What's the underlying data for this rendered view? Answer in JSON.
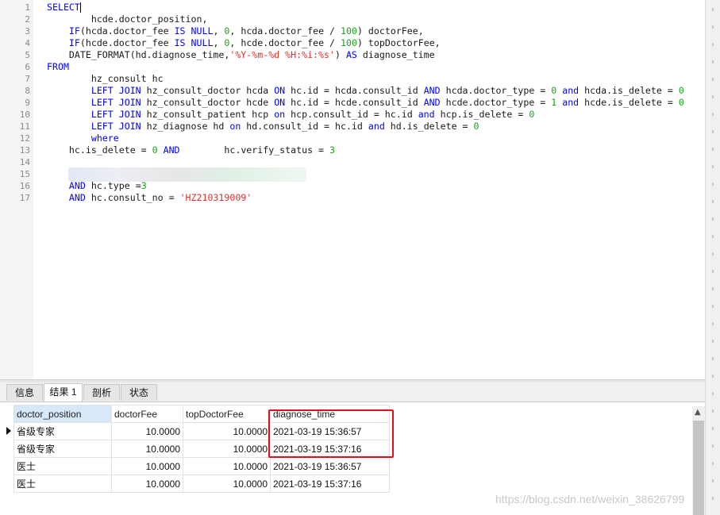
{
  "editor": {
    "line_numbers": [
      "1",
      "2",
      "3",
      "4",
      "5",
      "6",
      "7",
      "8",
      "9",
      "10",
      "11",
      "12",
      "13",
      "14",
      "15",
      "16",
      "17"
    ],
    "lines": [
      [
        {
          "t": "SELECT",
          "c": "kw"
        }
      ],
      [
        {
          "t": "        hcde.doctor_position,",
          "c": "plain"
        }
      ],
      [
        {
          "t": "    ",
          "c": "plain"
        },
        {
          "t": "IF",
          "c": "kw"
        },
        {
          "t": "(hcda.doctor_fee ",
          "c": "plain"
        },
        {
          "t": "IS NULL",
          "c": "kw"
        },
        {
          "t": ", ",
          "c": "plain"
        },
        {
          "t": "0",
          "c": "num"
        },
        {
          "t": ", hcda.doctor_fee / ",
          "c": "plain"
        },
        {
          "t": "100",
          "c": "num"
        },
        {
          "t": ") doctorFee,",
          "c": "plain"
        }
      ],
      [
        {
          "t": "    ",
          "c": "plain"
        },
        {
          "t": "IF",
          "c": "kw"
        },
        {
          "t": "(hcde.doctor_fee ",
          "c": "plain"
        },
        {
          "t": "IS NULL",
          "c": "kw"
        },
        {
          "t": ", ",
          "c": "plain"
        },
        {
          "t": "0",
          "c": "num"
        },
        {
          "t": ", hcde.doctor_fee / ",
          "c": "plain"
        },
        {
          "t": "100",
          "c": "num"
        },
        {
          "t": ") topDoctorFee,",
          "c": "plain"
        }
      ],
      [
        {
          "t": "    DATE_FORMAT(hd.diagnose_time,",
          "c": "plain"
        },
        {
          "t": "'%Y-%m-%d %H:%i:%s'",
          "c": "str"
        },
        {
          "t": ") ",
          "c": "plain"
        },
        {
          "t": "AS",
          "c": "kw"
        },
        {
          "t": " diagnose_time",
          "c": "plain"
        }
      ],
      [
        {
          "t": "FROM",
          "c": "kw"
        }
      ],
      [
        {
          "t": "        hz_consult hc",
          "c": "plain"
        }
      ],
      [
        {
          "t": "        ",
          "c": "plain"
        },
        {
          "t": "LEFT JOIN",
          "c": "kw"
        },
        {
          "t": " hz_consult_doctor hcda ",
          "c": "plain"
        },
        {
          "t": "ON",
          "c": "kw"
        },
        {
          "t": " hc.id = hcda.consult_id ",
          "c": "plain"
        },
        {
          "t": "AND",
          "c": "kw"
        },
        {
          "t": " hcda.doctor_type = ",
          "c": "plain"
        },
        {
          "t": "0",
          "c": "num"
        },
        {
          "t": " ",
          "c": "plain"
        },
        {
          "t": "and",
          "c": "kw"
        },
        {
          "t": " hcda.is_delete = ",
          "c": "plain"
        },
        {
          "t": "0",
          "c": "num"
        }
      ],
      [
        {
          "t": "        ",
          "c": "plain"
        },
        {
          "t": "LEFT JOIN",
          "c": "kw"
        },
        {
          "t": " hz_consult_doctor hcde ",
          "c": "plain"
        },
        {
          "t": "ON",
          "c": "kw"
        },
        {
          "t": " hc.id = hcde.consult_id ",
          "c": "plain"
        },
        {
          "t": "AND",
          "c": "kw"
        },
        {
          "t": " hcde.doctor_type = ",
          "c": "plain"
        },
        {
          "t": "1",
          "c": "num"
        },
        {
          "t": " ",
          "c": "plain"
        },
        {
          "t": "and",
          "c": "kw"
        },
        {
          "t": " hcde.is_delete = ",
          "c": "plain"
        },
        {
          "t": "0",
          "c": "num"
        }
      ],
      [
        {
          "t": "        ",
          "c": "plain"
        },
        {
          "t": "LEFT JOIN",
          "c": "kw"
        },
        {
          "t": " hz_consult_patient hcp ",
          "c": "plain"
        },
        {
          "t": "on",
          "c": "kw"
        },
        {
          "t": " hcp.consult_id = hc.id ",
          "c": "plain"
        },
        {
          "t": "and",
          "c": "kw"
        },
        {
          "t": " hcp.is_delete = ",
          "c": "plain"
        },
        {
          "t": "0",
          "c": "num"
        }
      ],
      [
        {
          "t": "        ",
          "c": "plain"
        },
        {
          "t": "LEFT JOIN",
          "c": "kw"
        },
        {
          "t": " hz_diagnose hd ",
          "c": "plain"
        },
        {
          "t": "on",
          "c": "kw"
        },
        {
          "t": " hd.consult_id = hc.id ",
          "c": "plain"
        },
        {
          "t": "and",
          "c": "kw"
        },
        {
          "t": " hd.is_delete = ",
          "c": "plain"
        },
        {
          "t": "0",
          "c": "num"
        }
      ],
      [
        {
          "t": "        ",
          "c": "plain"
        },
        {
          "t": "where",
          "c": "kw"
        }
      ],
      [
        {
          "t": "    hc.is_delete = ",
          "c": "plain"
        },
        {
          "t": "0",
          "c": "num"
        },
        {
          "t": " ",
          "c": "plain"
        },
        {
          "t": "AND",
          "c": "kw"
        },
        {
          "t": "        hc.verify_status = ",
          "c": "plain"
        },
        {
          "t": "3",
          "c": "num"
        }
      ],
      [],
      [],
      [
        {
          "t": "    ",
          "c": "plain"
        },
        {
          "t": "AND",
          "c": "kw"
        },
        {
          "t": " hc.type =",
          "c": "plain"
        },
        {
          "t": "3",
          "c": "num"
        }
      ],
      [
        {
          "t": "    ",
          "c": "plain"
        },
        {
          "t": "AND",
          "c": "kw"
        },
        {
          "t": " hc.consult_no = ",
          "c": "plain"
        },
        {
          "t": "'HZ210319009'",
          "c": "str"
        }
      ]
    ]
  },
  "tabs": [
    {
      "label": "信息",
      "active": false
    },
    {
      "label": "结果 1",
      "active": true
    },
    {
      "label": "剖析",
      "active": false
    },
    {
      "label": "状态",
      "active": false
    }
  ],
  "results": {
    "columns": [
      "doctor_position",
      "doctorFee",
      "topDoctorFee",
      "diagnose_time"
    ],
    "rows": [
      [
        "省级专家",
        "10.0000",
        "10.0000",
        "2021-03-19 15:36:57"
      ],
      [
        "省级专家",
        "10.0000",
        "10.0000",
        "2021-03-19 15:37:16"
      ],
      [
        "医士",
        "10.0000",
        "10.0000",
        "2021-03-19 15:36:57"
      ],
      [
        "医士",
        "10.0000",
        "10.0000",
        "2021-03-19 15:37:16"
      ]
    ]
  },
  "watermark": "https://blog.csdn.net/weixin_38626799",
  "colors": {
    "keyword": "#0000ff",
    "number": "#1aa31a",
    "string": "#e0302a",
    "highlight_box": "#e0101a",
    "selected_header": "#d7e9f8"
  }
}
